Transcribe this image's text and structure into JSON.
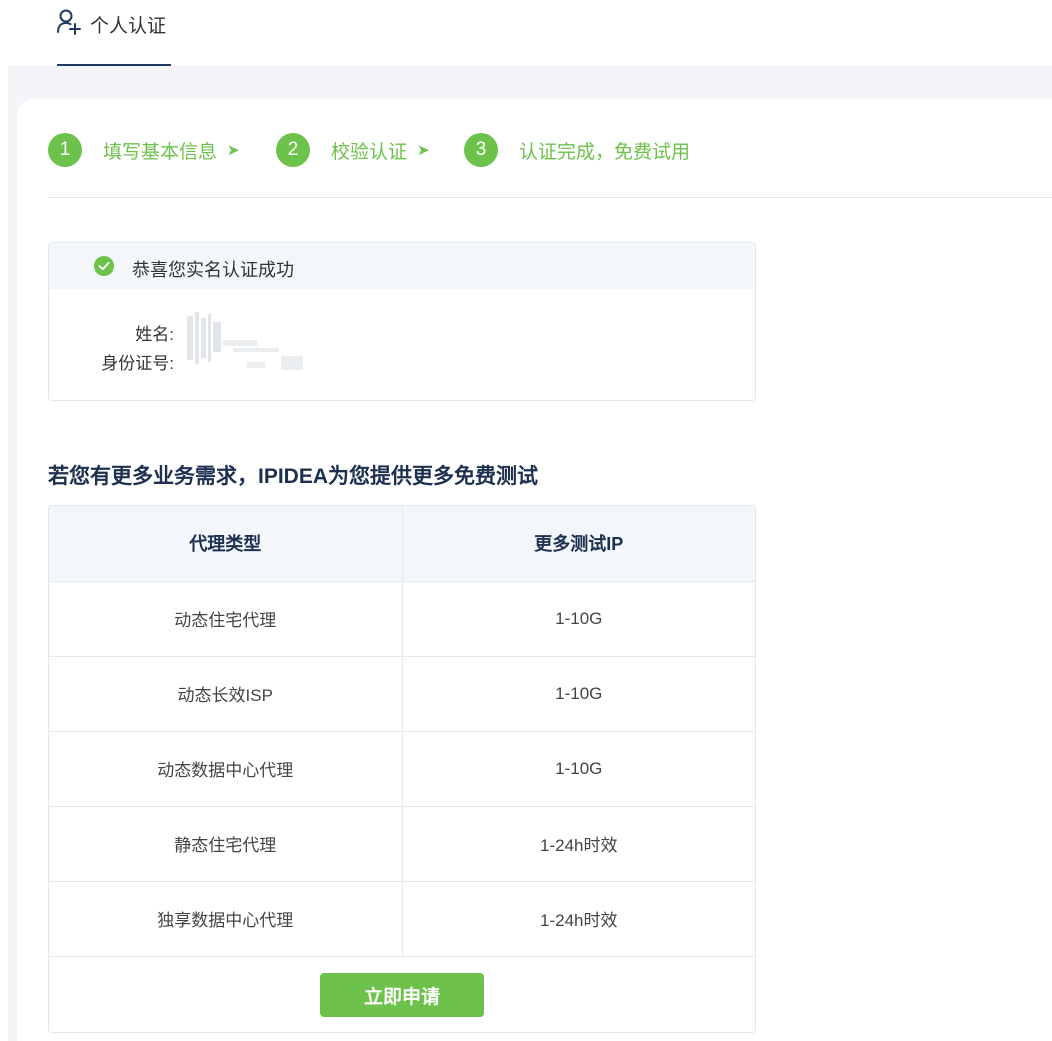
{
  "tab": {
    "label": "个人认证",
    "icon": "user-add-icon"
  },
  "steps": [
    {
      "num": "1",
      "label": "填写基本信息",
      "arrow": "➤"
    },
    {
      "num": "2",
      "label": "校验认证",
      "arrow": "➤"
    },
    {
      "num": "3",
      "label": "认证完成，免费试用",
      "arrow": ""
    }
  ],
  "success": {
    "message": "恭喜您实名认证成功",
    "icon": "check-circle-icon",
    "name_label": "姓名:",
    "id_label": "身份证号:"
  },
  "promo": {
    "title": "若您有更多业务需求，IPIDEA为您提供更多免费测试"
  },
  "table": {
    "headers": [
      "代理类型",
      "更多测试IP"
    ],
    "rows": [
      [
        "动态住宅代理",
        "1-10G"
      ],
      [
        "动态长效ISP",
        "1-10G"
      ],
      [
        "动态数据中心代理",
        "1-10G"
      ],
      [
        "静态住宅代理",
        "1-24h时效"
      ],
      [
        "独享数据中心代理",
        "1-24h时效"
      ]
    ]
  },
  "apply_button": "立即申请",
  "colors": {
    "accent": "#6cc24a",
    "heading": "#1e3050",
    "tab_underline": "#1e3a5f"
  }
}
